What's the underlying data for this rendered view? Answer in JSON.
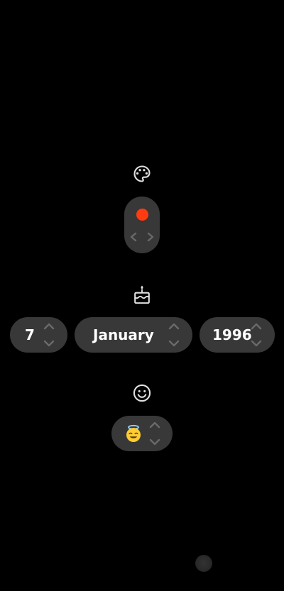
{
  "colors": {
    "background": "#000000",
    "control_bg": "#383838",
    "icon": "#e0e0e0",
    "arrow": "#6a6a6a",
    "selected_color": "#ff3b12"
  },
  "color_picker": {
    "icon": "palette-icon",
    "value": "red",
    "prev_icon": "chevron-left-icon",
    "next_icon": "chevron-right-icon"
  },
  "birthday": {
    "icon": "birthday-cake-icon",
    "day": "7",
    "month": "January",
    "year": "1996"
  },
  "mood": {
    "icon": "smiley-face-icon",
    "value": "😇"
  }
}
